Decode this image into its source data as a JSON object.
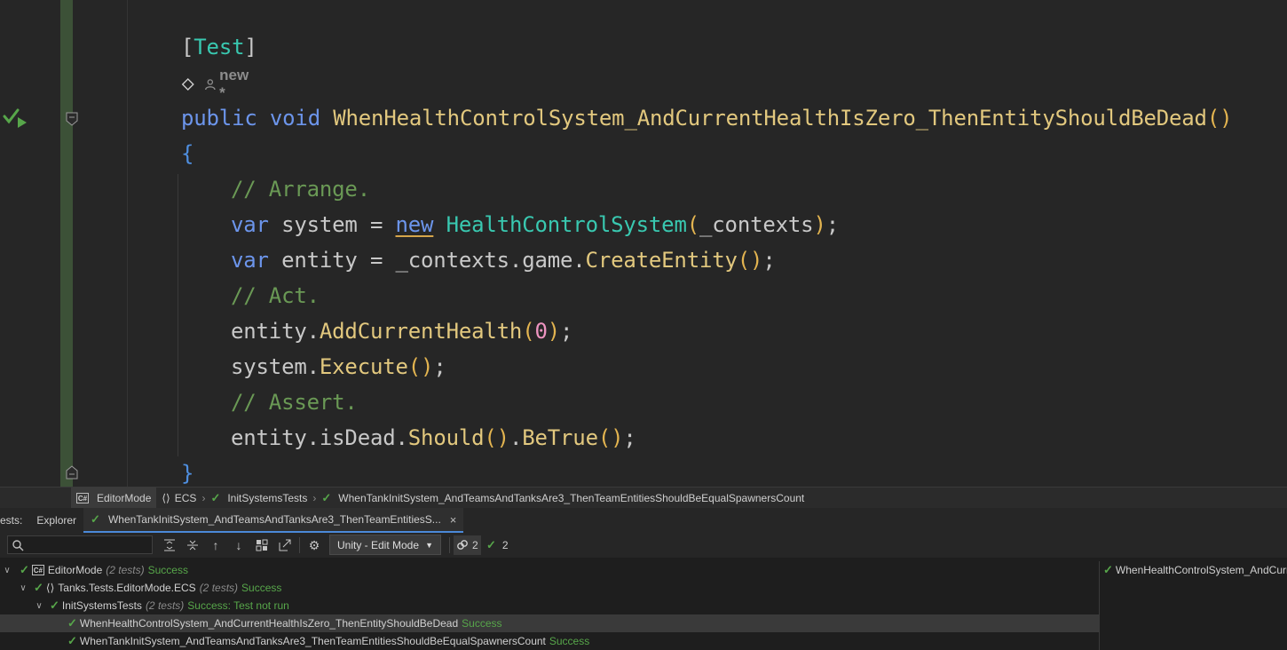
{
  "colors": {
    "editor_bg": "#262626",
    "gutter_stripe": "#3c5137",
    "keyword": "#6c95eb",
    "type": "#39c8b0",
    "method": "#e2c87e",
    "comment": "#6a9955",
    "success": "#57a64a"
  },
  "editor": {
    "attribute_open": "[",
    "attribute_name": "Test",
    "attribute_close": "]",
    "hint_author": "new *",
    "method_modifiers": "public void",
    "method_name": "WhenHealthControlSystem_AndCurrentHealthIsZero_ThenEntityShouldBeDead",
    "method_parens": "()",
    "open_brace": "{",
    "close_brace": "}",
    "comment_arrange": "// Arrange.",
    "comment_act": "// Act.",
    "comment_assert": "// Assert.",
    "line_var1_kw": "var",
    "line_var1_name": " system = ",
    "line_var1_new": "new",
    "line_var1_type": "HealthControlSystem",
    "line_var1_args": "_contexts",
    "line_var2_kw": "var",
    "line_var2_rest": " entity = _contexts.game.",
    "line_var2_method": "CreateEntity",
    "line_act1_obj": "entity.",
    "line_act1_method": "AddCurrentHealth",
    "line_act1_arg": "0",
    "line_act2_obj": "system.",
    "line_act2_method": "Execute",
    "line_assert_obj": "entity.isDead.",
    "line_assert_m1": "Should",
    "line_assert_m2": "BeTrue"
  },
  "breadcrumbs": [
    {
      "label": "EditorMode",
      "icon": "csharp-project-icon"
    },
    {
      "label": "ECS",
      "icon": "namespace-icon"
    },
    {
      "label": "InitSystemsTests",
      "icon": "check-icon"
    },
    {
      "label": "WhenTankInitSystem_AndTeamsAndTanksAre3_ThenTeamEntitiesShouldBeEqualSpawnersCount",
      "icon": "check-icon"
    }
  ],
  "tabs": {
    "prefix": "ests:",
    "explorer": "Explorer",
    "session": "WhenTankInitSystem_AndTeamsAndTanksAre3_ThenTeamEntitiesS...",
    "close": "×"
  },
  "toolbar": {
    "search_placeholder": "",
    "mode_dropdown": "Unity - Edit Mode",
    "dropdown_arrow": "▼",
    "total_count": "2",
    "passed_count": "2"
  },
  "tree": [
    {
      "label": "EditorMode",
      "count": "(2 tests)",
      "status": "Success"
    },
    {
      "label": "Tanks.Tests.EditorMode.ECS",
      "count": "(2 tests)",
      "status": "Success"
    },
    {
      "label": "InitSystemsTests",
      "count": "(2 tests)",
      "status": "Success: Test not run"
    },
    {
      "label": "WhenHealthControlSystem_AndCurrentHealthIsZero_ThenEntityShouldBeDead",
      "status": "Success"
    },
    {
      "label": "WhenTankInitSystem_AndTeamsAndTanksAre3_ThenTeamEntitiesShouldBeEqualSpawnersCount",
      "status": "Success"
    }
  ],
  "side_panel": {
    "title": "WhenHealthControlSystem_AndCurr"
  }
}
